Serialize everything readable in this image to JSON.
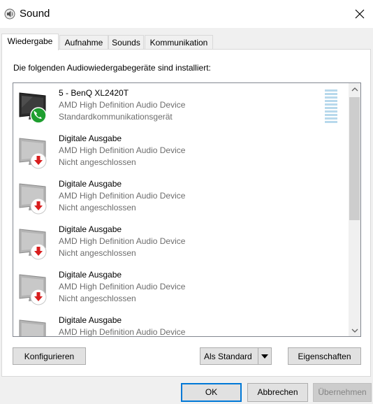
{
  "window": {
    "title": "Sound",
    "icon": "speaker-icon"
  },
  "tabs": [
    {
      "label": "Wiedergabe",
      "active": true
    },
    {
      "label": "Aufnahme",
      "active": false
    },
    {
      "label": "Sounds",
      "active": false
    },
    {
      "label": "Kommunikation",
      "active": false
    }
  ],
  "panel": {
    "heading": "Die folgenden Audiowiedergabegeräte sind installiert:"
  },
  "devices": [
    {
      "name": "5 - BenQ XL2420T",
      "driver": "AMD High Definition Audio Device",
      "status": "Standardkommunikationsgerät",
      "icon": "monitor-icon",
      "badge": "phone-badge"
    },
    {
      "name": "Digitale Ausgabe",
      "driver": "AMD High Definition Audio Device",
      "status": "Nicht angeschlossen",
      "icon": "monitor-icon",
      "badge": "down-arrow-badge"
    },
    {
      "name": "Digitale Ausgabe",
      "driver": "AMD High Definition Audio Device",
      "status": "Nicht angeschlossen",
      "icon": "monitor-icon",
      "badge": "down-arrow-badge"
    },
    {
      "name": "Digitale Ausgabe",
      "driver": "AMD High Definition Audio Device",
      "status": "Nicht angeschlossen",
      "icon": "monitor-icon",
      "badge": "down-arrow-badge"
    },
    {
      "name": "Digitale Ausgabe",
      "driver": "AMD High Definition Audio Device",
      "status": "Nicht angeschlossen",
      "icon": "monitor-icon",
      "badge": "down-arrow-badge"
    },
    {
      "name": "Digitale Ausgabe",
      "driver": "AMD High Definition Audio Device",
      "status": "",
      "icon": "monitor-icon",
      "badge": ""
    }
  ],
  "buttons": {
    "configure": "Konfigurieren",
    "set_default": "Als Standard",
    "properties": "Eigenschaften",
    "ok": "OK",
    "cancel": "Abbrechen",
    "apply": "Übernehmen"
  },
  "colors": {
    "phone_badge": "#1e9e2f",
    "arrow_badge": "#d81e1e",
    "level_meter": "#b8d9ec",
    "focus_border": "#0078d7"
  }
}
